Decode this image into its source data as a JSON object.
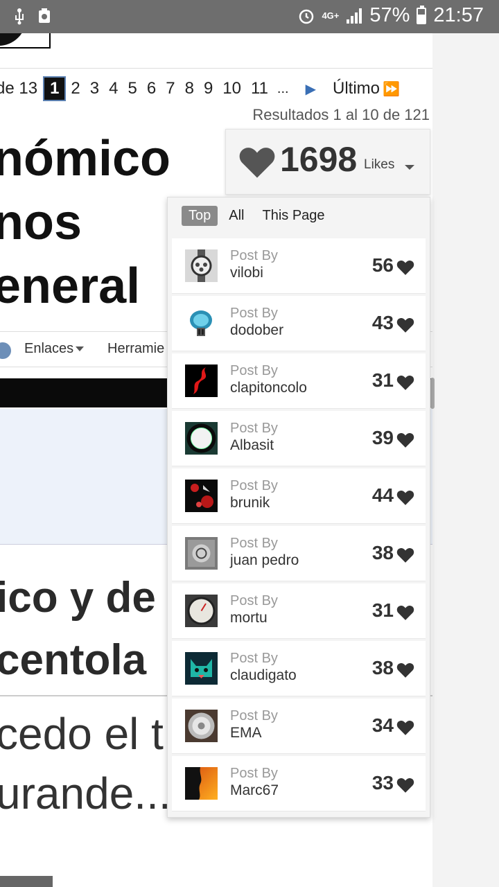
{
  "status_bar": {
    "network": "4G+",
    "battery": "57%",
    "battery_level": 0.57,
    "time": "21:57"
  },
  "pagination": {
    "prefix": "de 13",
    "current": "1",
    "pages": [
      "2",
      "3",
      "4",
      "5",
      "6",
      "7",
      "8",
      "9",
      "10",
      "11"
    ],
    "ellipsis": "...",
    "last_label": "Último"
  },
  "results_text": "Resultados 1 al 10 de 121",
  "thread_title": {
    "line1": "nómico",
    "line2": "nos",
    "line3": "eneral"
  },
  "navbar": {
    "links_label": "Enlaces",
    "tools_label": "Herramie"
  },
  "post_title": {
    "line1": "ico y de",
    "line2": "centola"
  },
  "post_excerpt": {
    "line1": "cedo el t",
    "line2": "urande..."
  },
  "likes": {
    "count": "1698",
    "label": "Likes",
    "tabs": [
      {
        "label": "Top",
        "active": true
      },
      {
        "label": "All",
        "active": false
      },
      {
        "label": "This Page",
        "active": false
      }
    ],
    "post_by_label": "Post By",
    "entries": [
      {
        "author": "vilobi",
        "count": "56",
        "avatar_icon": "watch-avatar-icon"
      },
      {
        "author": "dodober",
        "count": "43",
        "avatar_icon": "brain-skull-avatar-icon"
      },
      {
        "author": "clapitoncolo",
        "count": "31",
        "avatar_icon": "specialized-logo-avatar-icon"
      },
      {
        "author": "Albasit",
        "count": "39",
        "avatar_icon": "dial-avatar-icon"
      },
      {
        "author": "brunik",
        "count": "44",
        "avatar_icon": "watch-dial-avatar-icon"
      },
      {
        "author": "juan pedro",
        "count": "38",
        "avatar_icon": "watch-face-avatar-icon"
      },
      {
        "author": "mortu",
        "count": "31",
        "avatar_icon": "gauge-avatar-icon"
      },
      {
        "author": "claudigato",
        "count": "38",
        "avatar_icon": "cat-avatar-icon"
      },
      {
        "author": "EMA",
        "count": "34",
        "avatar_icon": "silver-watch-avatar-icon"
      },
      {
        "author": "Marc67",
        "count": "33",
        "avatar_icon": "silhouette-avatar-icon"
      }
    ]
  },
  "colors": {
    "status_bar": "#6e6e6e",
    "heart": "#333333",
    "link_blue": "#3a6fb5"
  }
}
